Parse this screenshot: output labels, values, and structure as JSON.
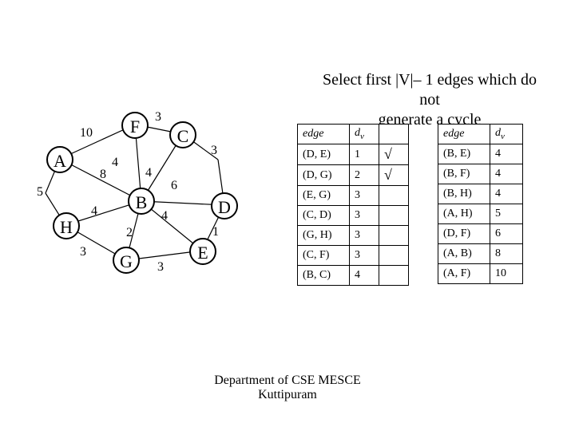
{
  "title_line1": "Select first |V|– 1 edges which do not",
  "title_line2": "generate a cycle",
  "nodes": {
    "A": "A",
    "B": "B",
    "C": "C",
    "D": "D",
    "E": "E",
    "F": "F",
    "G": "G",
    "H": "H"
  },
  "weights": {
    "AF": "10",
    "FC": "3",
    "AB": "4",
    "AH": "5",
    "BF": "8",
    "BC": "4",
    "CD": "3",
    "BD": "6",
    "BH": "4",
    "BG": "2",
    "GE": "3",
    "DE": "1",
    "HG": "3",
    "BE": "4"
  },
  "headers": {
    "edge": "edge",
    "dv_d": "d",
    "dv_v": "v"
  },
  "table1": [
    {
      "e": "(D, E)",
      "d": "1",
      "c": "√"
    },
    {
      "e": "(D, G)",
      "d": "2",
      "c": "√"
    },
    {
      "e": "(E, G)",
      "d": "3",
      "c": ""
    },
    {
      "e": "(C, D)",
      "d": "3",
      "c": ""
    },
    {
      "e": "(G, H)",
      "d": "3",
      "c": ""
    },
    {
      "e": "(C, F)",
      "d": "3",
      "c": ""
    },
    {
      "e": "(B, C)",
      "d": "4",
      "c": ""
    }
  ],
  "table2": [
    {
      "e": "(B, E)",
      "d": "4"
    },
    {
      "e": "(B, F)",
      "d": "4"
    },
    {
      "e": "(B, H)",
      "d": "4"
    },
    {
      "e": "(A, H)",
      "d": "5"
    },
    {
      "e": "(D, F)",
      "d": "6"
    },
    {
      "e": "(A, B)",
      "d": "8"
    },
    {
      "e": "(A, F)",
      "d": "10"
    }
  ],
  "footer_line1": "Department of CSE MESCE",
  "footer_line2": "Kuttipuram"
}
